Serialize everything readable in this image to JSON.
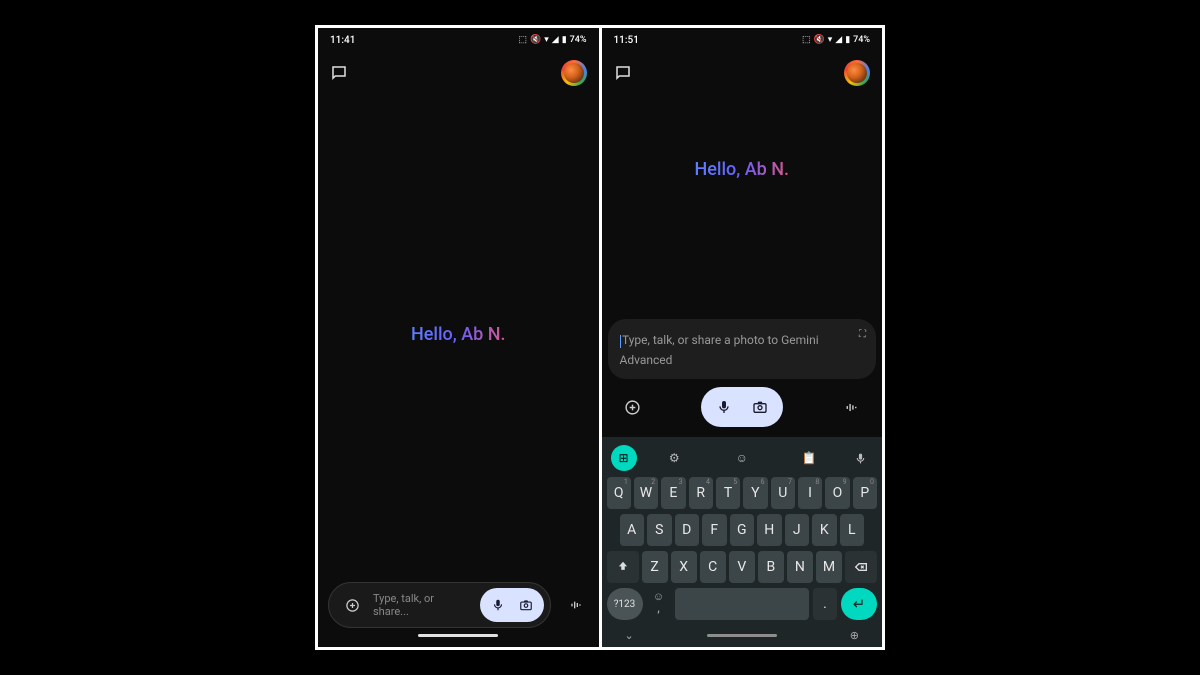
{
  "left": {
    "status": {
      "time": "11:41",
      "battery": "74%"
    },
    "greeting": "Hello, Ab N.",
    "input": {
      "placeholder": "Type, talk, or share..."
    }
  },
  "right": {
    "status": {
      "time": "11:51",
      "battery": "74%"
    },
    "greeting": "Hello, Ab N.",
    "input": {
      "placeholder": "Type, talk, or share a photo to Gemini Advanced"
    },
    "keyboard": {
      "row1": [
        {
          "k": "Q",
          "s": "1"
        },
        {
          "k": "W",
          "s": "2"
        },
        {
          "k": "E",
          "s": "3"
        },
        {
          "k": "R",
          "s": "4"
        },
        {
          "k": "T",
          "s": "5"
        },
        {
          "k": "Y",
          "s": "6"
        },
        {
          "k": "U",
          "s": "7"
        },
        {
          "k": "I",
          "s": "8"
        },
        {
          "k": "O",
          "s": "9"
        },
        {
          "k": "P",
          "s": "0"
        }
      ],
      "row2": [
        "A",
        "S",
        "D",
        "F",
        "G",
        "H",
        "J",
        "K",
        "L"
      ],
      "row3": [
        "Z",
        "X",
        "C",
        "V",
        "B",
        "N",
        "M"
      ],
      "symkey": "?123",
      "period": "."
    }
  }
}
